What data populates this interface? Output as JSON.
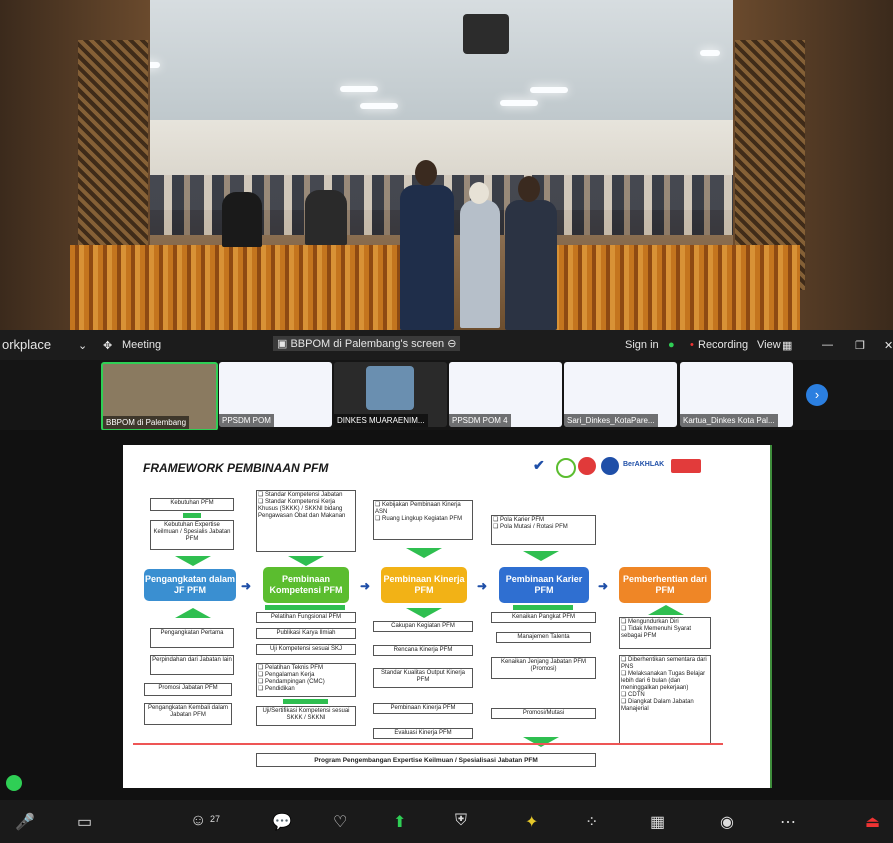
{
  "zoom": {
    "app_title": "orkplace",
    "meeting_label": "Meeting",
    "screen_share_label": "BBPOM di Palembang's screen",
    "sign_in": "Sign in",
    "recording": "Recording",
    "view": "View"
  },
  "thumbnails": [
    {
      "name": "BBPOM di Palembang"
    },
    {
      "name": "PPSDM POM"
    },
    {
      "name": "DINKES MUARAENIM..."
    },
    {
      "name": "PPSDM POM 4"
    },
    {
      "name": "Sari_Dinkes_KotaPare..."
    },
    {
      "name": "Kartua_Dinkes Kota Pal..."
    }
  ],
  "slide": {
    "title": "FRAMEWORK PEMBINAAN PFM",
    "logos": [
      "BerAKHLAK"
    ],
    "stages": [
      {
        "label": "Pengangkatan dalam JF PFM",
        "color": "#3a8fd1"
      },
      {
        "label": "Pembinaan Kompetensi PFM",
        "color": "#5bbd2f"
      },
      {
        "label": "Pembinaan Kinerja PFM",
        "color": "#f2b216"
      },
      {
        "label": "Pembinaan Karier PFM",
        "color": "#2f6fd1"
      },
      {
        "label": "Pemberhentian dari PFM",
        "color": "#ef8626"
      }
    ],
    "col1_top": [
      "Kebutuhan PFM",
      "Kebutuhan Expertise Keilmuan / Spesialis Jabatan PFM"
    ],
    "col1_bottom": [
      "Pengangkatan Pertama",
      "Perpindahan dari Jabatan lain",
      "Promosi Jabatan PFM",
      "Pengangkatan Kembali dalam Jabatan PFM"
    ],
    "col2_top": "❑ Standar Kompetensi Jabatan\n❑ Standar Kompetensi Kerja Khusus (SKKK) / SKKNI bidang Pengawasan Obat dan Makanan",
    "col2_bottom": [
      "Pelatihan Fungsional PFM",
      "Publikasi Karya Ilmiah",
      "Uji Kompetensi sesuai SKJ"
    ],
    "col2_list": "❑ Pelatihan Teknis PFM\n❑ Pengalaman Kerja\n❑ Pendampingan (CMC)\n❑ Pendidikan",
    "col2_cert": "Uji/Sertifikasi Kompetensi sesuai SKKK / SKKNI",
    "col3_top": "❑ Kebijakan Pembinaan Kinerja ASN\n❑ Ruang Lingkup Kegiatan PFM",
    "col3_bottom": [
      "Cakupan Kegiatan PFM",
      "Rencana Kinerja PFM",
      "Standar Kualitas Output Kinerja PFM",
      "Pembinaan Kinerja PFM",
      "Evaluasi Kinerja PFM"
    ],
    "col4_top": "❑ Pola Karier PFM\n❑ Pola Mutasi / Rotasi PFM",
    "col4_bottom": [
      "Kenaikan Pangkat PFM",
      "Manajemen Talenta",
      "Kenaikan Jenjang Jabatan PFM (Promosi)",
      "Promosi/Mutasi"
    ],
    "col5_a": "❑ Mengundurkan Diri\n❑ Tidak Memenuhi Syarat sebagai PFM",
    "col5_b": "❑ Diberhentikan sementara dari PNS\n❑ Melaksanakan Tugas Belajar lebih dari 6 bulan (dan meninggalkan pekerjaan)\n❑ CDTN\n❑ Diangkat Dalam Jabatan Manajerial",
    "footer": "Program Pengembangan Expertise Keilmuan / Spesialisasi Jabatan PFM"
  },
  "dock": [
    {
      "label": "Audio",
      "icon": "mic-muted-icon"
    },
    {
      "label": "Video",
      "icon": "video-icon"
    },
    {
      "label": "27",
      "icon": "participants-icon"
    },
    {
      "label": "Chat",
      "icon": "chat-icon"
    },
    {
      "label": "React",
      "icon": "react-icon"
    },
    {
      "label": "Share",
      "icon": "share-icon"
    },
    {
      "label": "Host tools",
      "icon": "shield-icon"
    },
    {
      "label": "AI Companion",
      "icon": "sparkle-icon"
    },
    {
      "label": "Apps",
      "icon": "apps-icon"
    },
    {
      "label": "Breakout rooms",
      "icon": "grid-icon"
    },
    {
      "label": "Record",
      "icon": "record-icon"
    },
    {
      "label": "More",
      "icon": "more-icon"
    },
    {
      "label": "Leave",
      "icon": "leave-icon"
    }
  ]
}
